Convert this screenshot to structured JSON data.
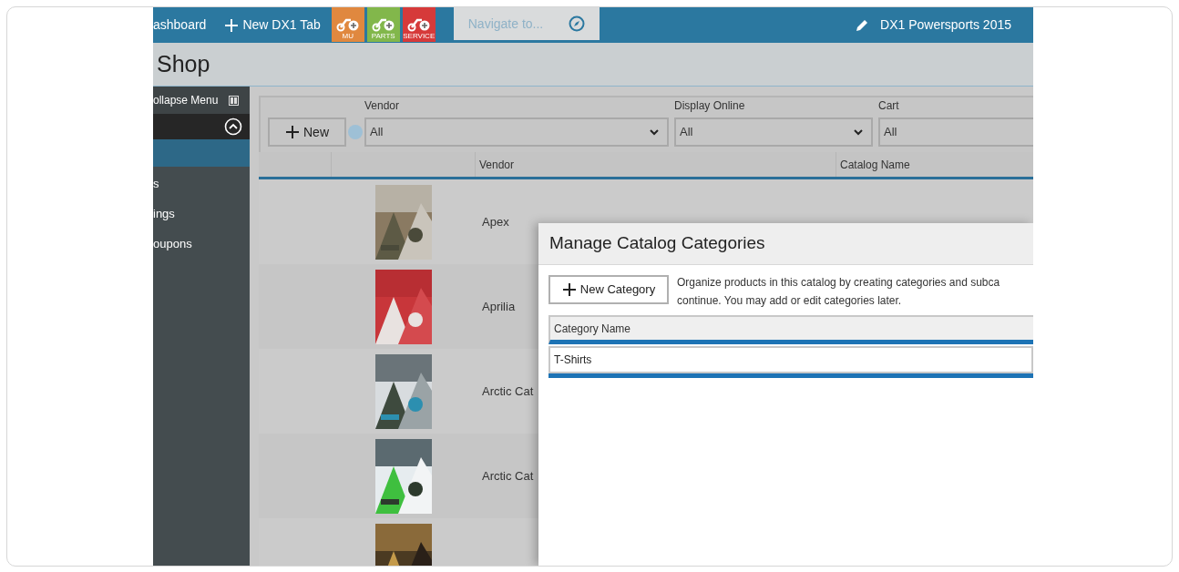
{
  "top_bar": {
    "links": [
      {
        "kind": "text",
        "label": "ashboard"
      },
      {
        "kind": "plus",
        "label": "New DX1 Tab"
      }
    ],
    "tiles": [
      {
        "label": "MU",
        "color": "#e0883f"
      },
      {
        "label": "PARTS",
        "color": "#82b74b"
      },
      {
        "label": "SERVICE",
        "color": "#d63a3a"
      }
    ],
    "navigate": {
      "placeholder": "Navigate to..."
    },
    "account": "DX1 Powersports 2015"
  },
  "page_title": "Shop",
  "sidebar": {
    "collapse_label": "ollapse Menu",
    "items": [
      "s",
      "ings",
      "oupons"
    ]
  },
  "filters": {
    "new_button": "New",
    "selects": [
      {
        "label": "Vendor",
        "value": "All"
      },
      {
        "label": "Display Online",
        "value": "All"
      },
      {
        "label": "Cart",
        "value": "All"
      }
    ]
  },
  "table": {
    "columns": [
      "Vendor",
      "Catalog Name"
    ],
    "rows": [
      {
        "thumbnail": {
          "kind": "picture"
        },
        "vendor": "Apex"
      },
      {
        "thumbnail": {
          "kind": "picture"
        },
        "vendor": "Aprilia"
      },
      {
        "thumbnail": {
          "kind": "picture"
        },
        "vendor": "Arctic Cat"
      },
      {
        "thumbnail": {
          "kind": "picture"
        },
        "vendor": "Arctic Cat"
      },
      {
        "thumbnail": {
          "kind": "picture"
        }
      }
    ]
  },
  "dialog": {
    "title": "Manage Catalog Categories",
    "new_button": "New Category",
    "description": [
      "Organize products in this catalog by creating categories and subca",
      "continue. You may add or edit categories later."
    ],
    "column": "Category Name",
    "rows": [
      {
        "value": "T-Shirts"
      }
    ]
  }
}
